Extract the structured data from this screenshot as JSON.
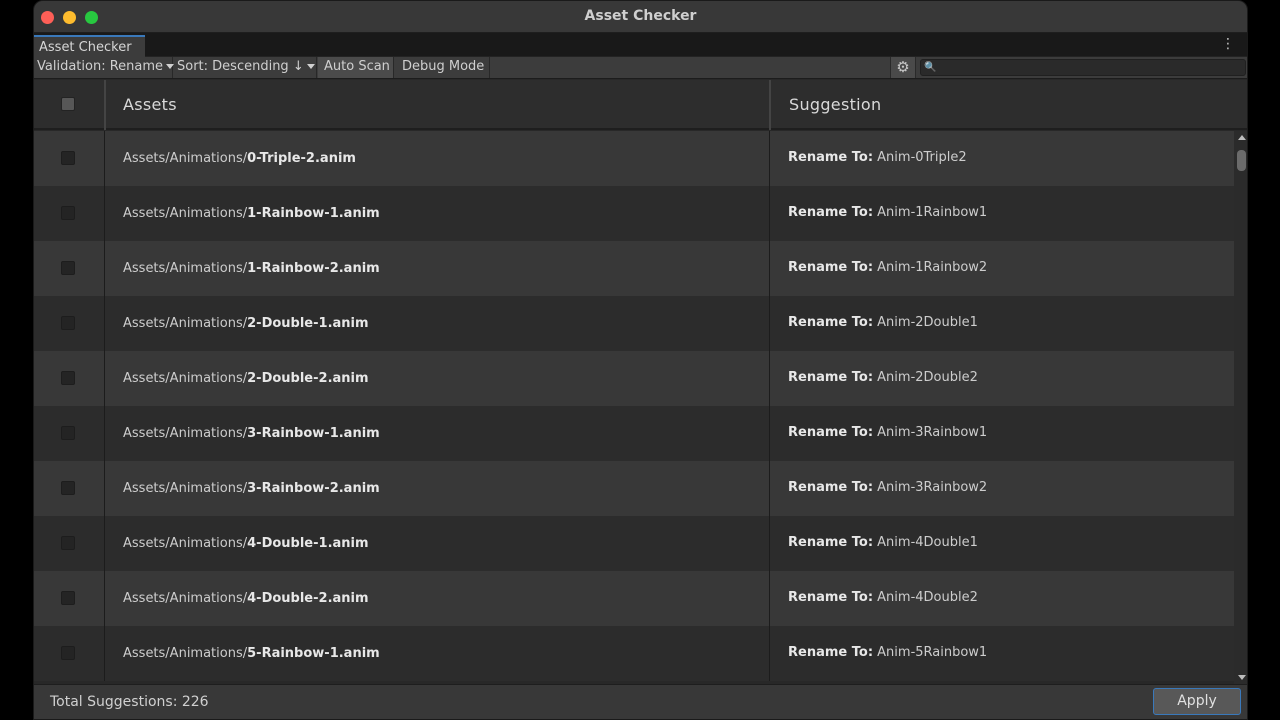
{
  "window": {
    "title": "Asset Checker"
  },
  "tab": {
    "label": "Asset Checker",
    "menu_icon": "kebab-menu-icon"
  },
  "toolbar": {
    "validation_label": "Validation: Rename",
    "sort_label": "Sort: Descending ↓",
    "auto_scan_label": "Auto Scan",
    "debug_mode_label": "Debug Mode",
    "settings_icon": "gear-icon",
    "search_icon": "search-icon",
    "search_value": ""
  },
  "table": {
    "columns": [
      "Assets",
      "Suggestion"
    ],
    "suggestion_prefix": "Rename To:",
    "rows": [
      {
        "folder": "Assets/Animations/",
        "file": "0-Triple-2.anim",
        "suggestion": "Anim-0Triple2"
      },
      {
        "folder": "Assets/Animations/",
        "file": "1-Rainbow-1.anim",
        "suggestion": "Anim-1Rainbow1"
      },
      {
        "folder": "Assets/Animations/",
        "file": "1-Rainbow-2.anim",
        "suggestion": "Anim-1Rainbow2"
      },
      {
        "folder": "Assets/Animations/",
        "file": "2-Double-1.anim",
        "suggestion": "Anim-2Double1"
      },
      {
        "folder": "Assets/Animations/",
        "file": "2-Double-2.anim",
        "suggestion": "Anim-2Double2"
      },
      {
        "folder": "Assets/Animations/",
        "file": "3-Rainbow-1.anim",
        "suggestion": "Anim-3Rainbow1"
      },
      {
        "folder": "Assets/Animations/",
        "file": "3-Rainbow-2.anim",
        "suggestion": "Anim-3Rainbow2"
      },
      {
        "folder": "Assets/Animations/",
        "file": "4-Double-1.anim",
        "suggestion": "Anim-4Double1"
      },
      {
        "folder": "Assets/Animations/",
        "file": "4-Double-2.anim",
        "suggestion": "Anim-4Double2"
      },
      {
        "folder": "Assets/Animations/",
        "file": "5-Rainbow-1.anim",
        "suggestion": "Anim-5Rainbow1"
      }
    ]
  },
  "footer": {
    "total_label": "Total Suggestions: 226",
    "apply_label": "Apply"
  },
  "colors": {
    "accent": "#3a79bb",
    "close": "#fe5f57",
    "minimize": "#febc2e",
    "maximize": "#28c840"
  }
}
